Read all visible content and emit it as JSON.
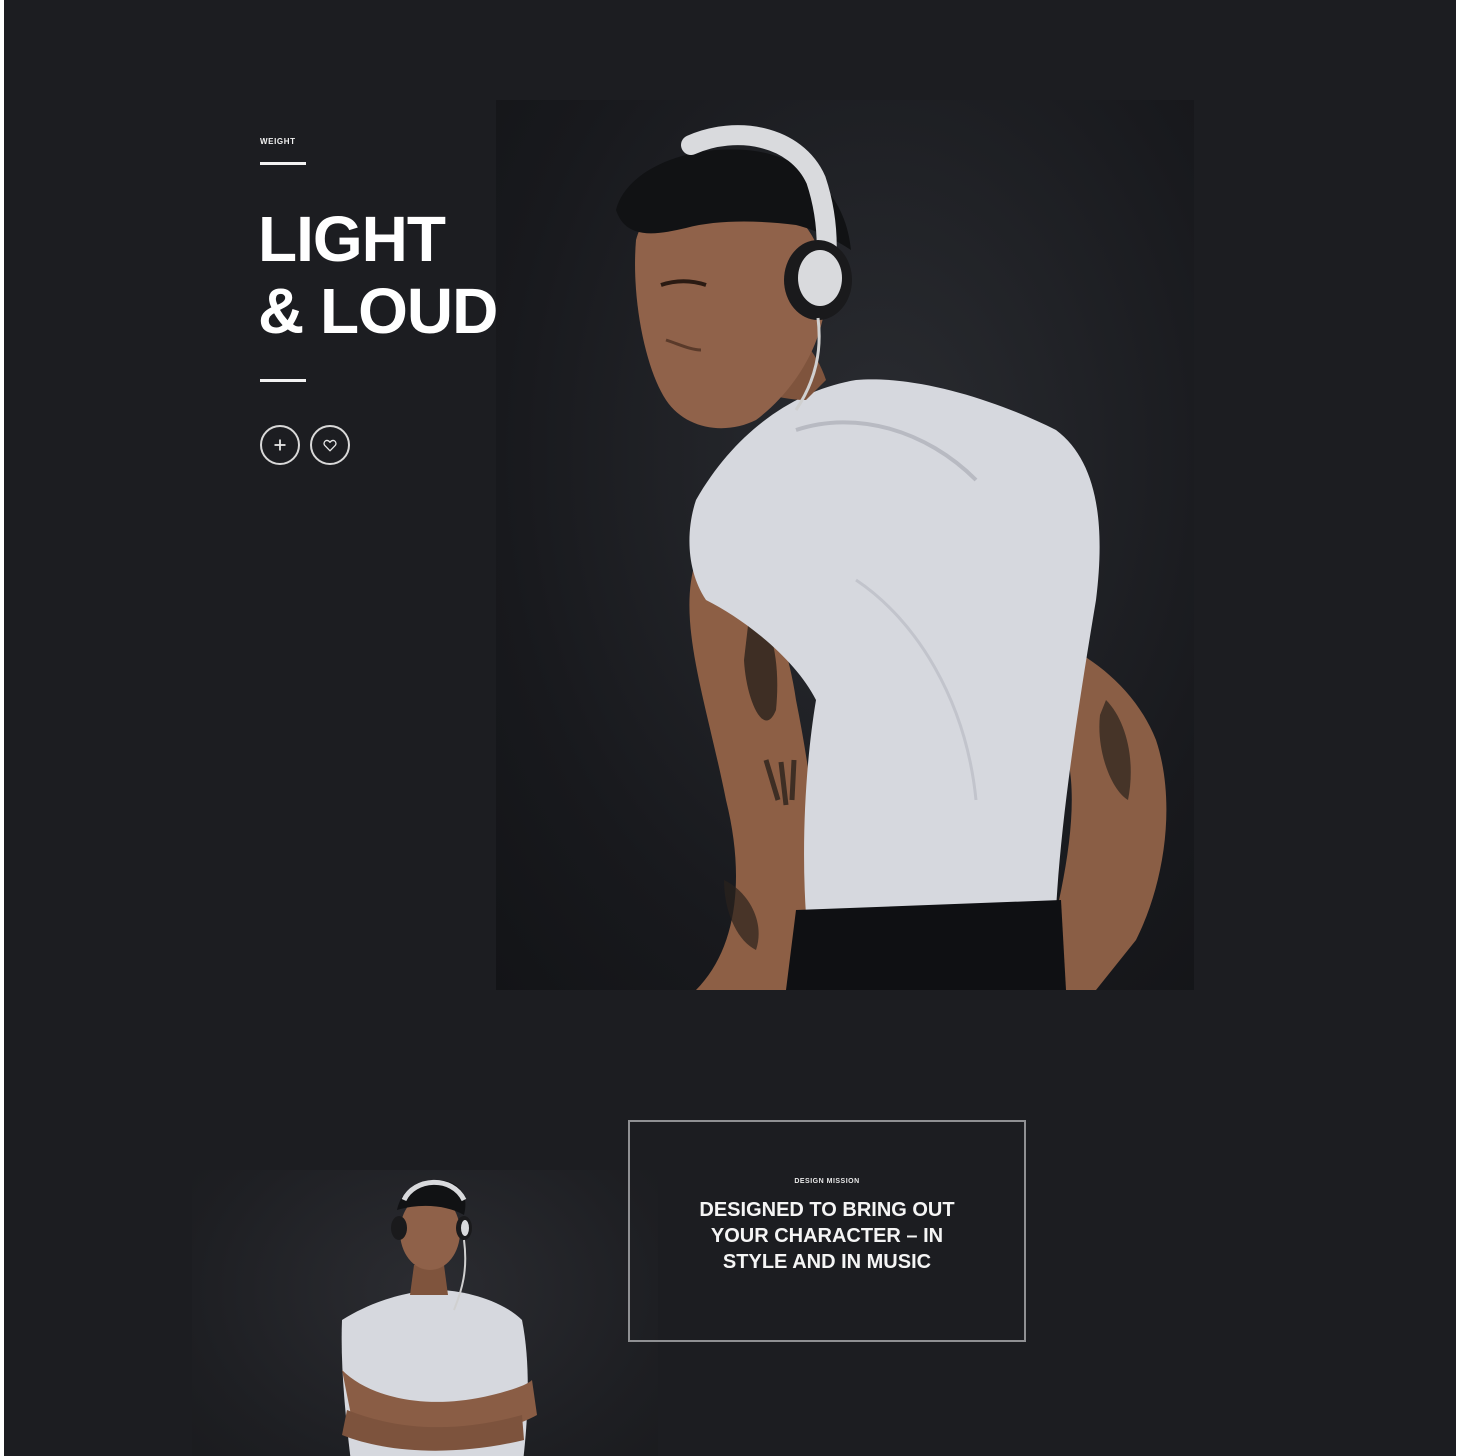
{
  "hero": {
    "eyebrow": "WEIGHT",
    "headline_line1": "LIGHT",
    "headline_line2": "& LOUD",
    "buttons": {
      "add_icon": "plus-icon",
      "like_icon": "heart-icon"
    },
    "photo_subject": "man-with-headphones-looking-back"
  },
  "mission": {
    "label": "DESIGN MISSION",
    "text": "DESIGNED TO BRING OUT YOUR CHARACTER – IN STYLE AND IN MUSIC"
  },
  "small_photo": {
    "subject": "man-with-headphones-arms-crossed"
  },
  "colors": {
    "background": "#1c1d21",
    "text": "#ffffff",
    "border": "#8f9093"
  }
}
